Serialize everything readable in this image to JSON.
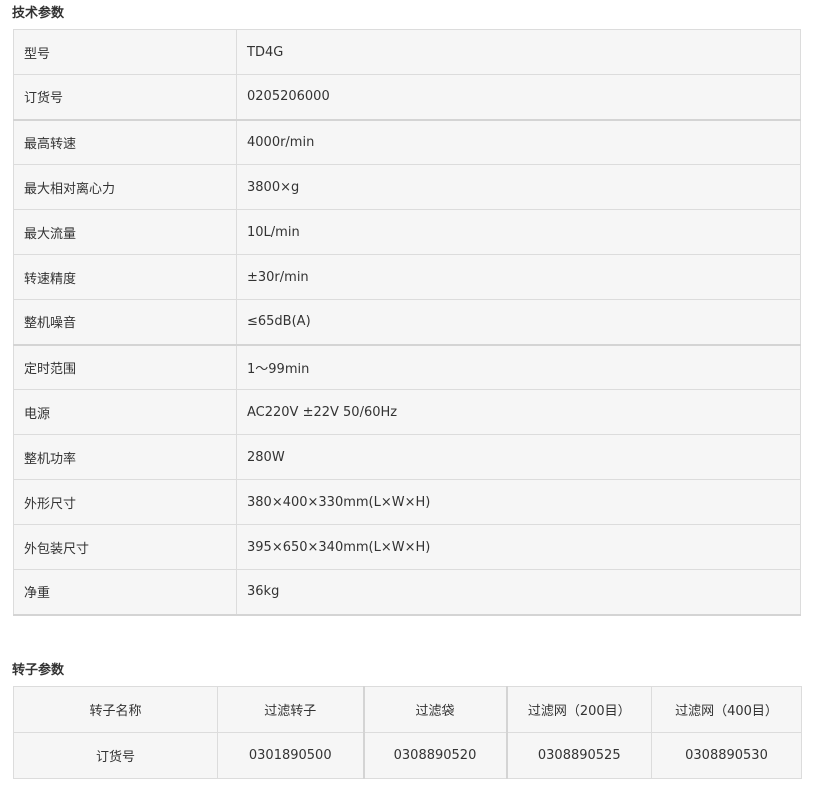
{
  "tech_section": {
    "title": "技术参数",
    "rows": [
      {
        "label": "型号",
        "value": "TD4G"
      },
      {
        "label": "订货号",
        "value": "0205206000"
      },
      {
        "label": "最高转速",
        "value": "4000r/min"
      },
      {
        "label": "最大相对离心力",
        "value": "3800×g"
      },
      {
        "label": "最大流量",
        "value": "10L/min"
      },
      {
        "label": "转速精度",
        "value": "±30r/min"
      },
      {
        "label": "整机噪音",
        "value": "≤65dB(A)"
      },
      {
        "label": "定时范围",
        "value": "1～99min"
      },
      {
        "label": "电源",
        "value": "AC220V ±22V 50/60Hz"
      },
      {
        "label": "整机功率",
        "value": "280W"
      },
      {
        "label": "外形尺寸",
        "value": "380×400×330mm(L×W×H)"
      },
      {
        "label": "外包装尺寸",
        "value": "395×650×340mm(L×W×H)"
      },
      {
        "label": "净重",
        "value": "36kg"
      }
    ]
  },
  "rotor_section": {
    "title": "转子参数",
    "header": [
      "转子名称",
      "过滤转子",
      "过滤袋",
      "过滤网（200目）",
      "过滤网（400目）"
    ],
    "order_row": [
      "订货号",
      "0301890500",
      "0308890520",
      "0308890525",
      "0308890530"
    ]
  }
}
